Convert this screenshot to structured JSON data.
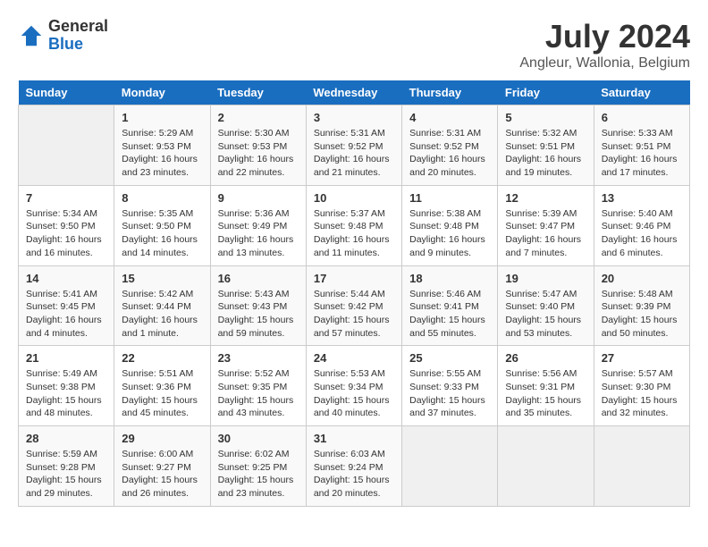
{
  "logo": {
    "general": "General",
    "blue": "Blue"
  },
  "title": "July 2024",
  "subtitle": "Angleur, Wallonia, Belgium",
  "days_header": [
    "Sunday",
    "Monday",
    "Tuesday",
    "Wednesday",
    "Thursday",
    "Friday",
    "Saturday"
  ],
  "weeks": [
    [
      {
        "day": "",
        "info": ""
      },
      {
        "day": "1",
        "info": "Sunrise: 5:29 AM\nSunset: 9:53 PM\nDaylight: 16 hours\nand 23 minutes."
      },
      {
        "day": "2",
        "info": "Sunrise: 5:30 AM\nSunset: 9:53 PM\nDaylight: 16 hours\nand 22 minutes."
      },
      {
        "day": "3",
        "info": "Sunrise: 5:31 AM\nSunset: 9:52 PM\nDaylight: 16 hours\nand 21 minutes."
      },
      {
        "day": "4",
        "info": "Sunrise: 5:31 AM\nSunset: 9:52 PM\nDaylight: 16 hours\nand 20 minutes."
      },
      {
        "day": "5",
        "info": "Sunrise: 5:32 AM\nSunset: 9:51 PM\nDaylight: 16 hours\nand 19 minutes."
      },
      {
        "day": "6",
        "info": "Sunrise: 5:33 AM\nSunset: 9:51 PM\nDaylight: 16 hours\nand 17 minutes."
      }
    ],
    [
      {
        "day": "7",
        "info": "Sunrise: 5:34 AM\nSunset: 9:50 PM\nDaylight: 16 hours\nand 16 minutes."
      },
      {
        "day": "8",
        "info": "Sunrise: 5:35 AM\nSunset: 9:50 PM\nDaylight: 16 hours\nand 14 minutes."
      },
      {
        "day": "9",
        "info": "Sunrise: 5:36 AM\nSunset: 9:49 PM\nDaylight: 16 hours\nand 13 minutes."
      },
      {
        "day": "10",
        "info": "Sunrise: 5:37 AM\nSunset: 9:48 PM\nDaylight: 16 hours\nand 11 minutes."
      },
      {
        "day": "11",
        "info": "Sunrise: 5:38 AM\nSunset: 9:48 PM\nDaylight: 16 hours\nand 9 minutes."
      },
      {
        "day": "12",
        "info": "Sunrise: 5:39 AM\nSunset: 9:47 PM\nDaylight: 16 hours\nand 7 minutes."
      },
      {
        "day": "13",
        "info": "Sunrise: 5:40 AM\nSunset: 9:46 PM\nDaylight: 16 hours\nand 6 minutes."
      }
    ],
    [
      {
        "day": "14",
        "info": "Sunrise: 5:41 AM\nSunset: 9:45 PM\nDaylight: 16 hours\nand 4 minutes."
      },
      {
        "day": "15",
        "info": "Sunrise: 5:42 AM\nSunset: 9:44 PM\nDaylight: 16 hours\nand 1 minute."
      },
      {
        "day": "16",
        "info": "Sunrise: 5:43 AM\nSunset: 9:43 PM\nDaylight: 15 hours\nand 59 minutes."
      },
      {
        "day": "17",
        "info": "Sunrise: 5:44 AM\nSunset: 9:42 PM\nDaylight: 15 hours\nand 57 minutes."
      },
      {
        "day": "18",
        "info": "Sunrise: 5:46 AM\nSunset: 9:41 PM\nDaylight: 15 hours\nand 55 minutes."
      },
      {
        "day": "19",
        "info": "Sunrise: 5:47 AM\nSunset: 9:40 PM\nDaylight: 15 hours\nand 53 minutes."
      },
      {
        "day": "20",
        "info": "Sunrise: 5:48 AM\nSunset: 9:39 PM\nDaylight: 15 hours\nand 50 minutes."
      }
    ],
    [
      {
        "day": "21",
        "info": "Sunrise: 5:49 AM\nSunset: 9:38 PM\nDaylight: 15 hours\nand 48 minutes."
      },
      {
        "day": "22",
        "info": "Sunrise: 5:51 AM\nSunset: 9:36 PM\nDaylight: 15 hours\nand 45 minutes."
      },
      {
        "day": "23",
        "info": "Sunrise: 5:52 AM\nSunset: 9:35 PM\nDaylight: 15 hours\nand 43 minutes."
      },
      {
        "day": "24",
        "info": "Sunrise: 5:53 AM\nSunset: 9:34 PM\nDaylight: 15 hours\nand 40 minutes."
      },
      {
        "day": "25",
        "info": "Sunrise: 5:55 AM\nSunset: 9:33 PM\nDaylight: 15 hours\nand 37 minutes."
      },
      {
        "day": "26",
        "info": "Sunrise: 5:56 AM\nSunset: 9:31 PM\nDaylight: 15 hours\nand 35 minutes."
      },
      {
        "day": "27",
        "info": "Sunrise: 5:57 AM\nSunset: 9:30 PM\nDaylight: 15 hours\nand 32 minutes."
      }
    ],
    [
      {
        "day": "28",
        "info": "Sunrise: 5:59 AM\nSunset: 9:28 PM\nDaylight: 15 hours\nand 29 minutes."
      },
      {
        "day": "29",
        "info": "Sunrise: 6:00 AM\nSunset: 9:27 PM\nDaylight: 15 hours\nand 26 minutes."
      },
      {
        "day": "30",
        "info": "Sunrise: 6:02 AM\nSunset: 9:25 PM\nDaylight: 15 hours\nand 23 minutes."
      },
      {
        "day": "31",
        "info": "Sunrise: 6:03 AM\nSunset: 9:24 PM\nDaylight: 15 hours\nand 20 minutes."
      },
      {
        "day": "",
        "info": ""
      },
      {
        "day": "",
        "info": ""
      },
      {
        "day": "",
        "info": ""
      }
    ]
  ]
}
